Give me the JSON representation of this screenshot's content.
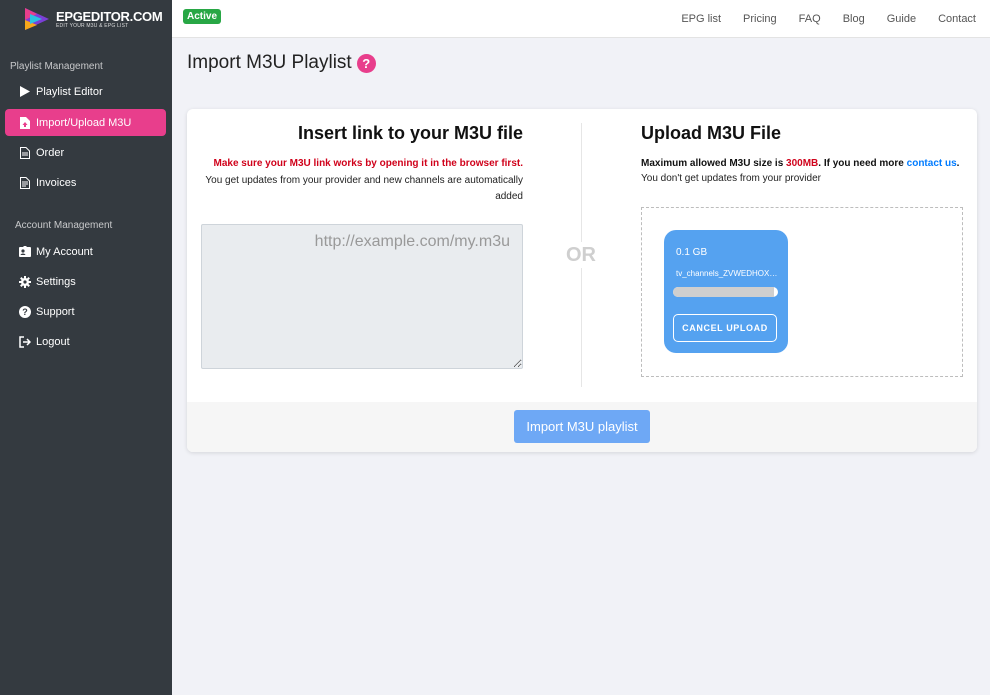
{
  "brand": {
    "name": "EPGEDITOR.COM",
    "tagline": "EDIT YOUR M3U & EPG LIST"
  },
  "sidebar": {
    "sections": [
      {
        "title": "Playlist Management"
      },
      {
        "title": "Account Management"
      }
    ],
    "items": [
      {
        "label": "Playlist Editor",
        "icon": "play-icon"
      },
      {
        "label": "Import/Upload M3U",
        "icon": "file-upload-icon",
        "active": true
      },
      {
        "label": "Order",
        "icon": "file-icon"
      },
      {
        "label": "Invoices",
        "icon": "file-text-icon"
      },
      {
        "label": "My Account",
        "icon": "id-card-icon"
      },
      {
        "label": "Settings",
        "icon": "gear-icon"
      },
      {
        "label": "Support",
        "icon": "question-circle-icon"
      },
      {
        "label": "Logout",
        "icon": "sign-out-icon"
      }
    ]
  },
  "topbar": {
    "status_badge": "Active",
    "links": [
      "EPG list",
      "Pricing",
      "FAQ",
      "Blog",
      "Guide",
      "Contact"
    ]
  },
  "page": {
    "title": "Import M3U Playlist",
    "help": "?"
  },
  "link_panel": {
    "title": "Insert link to your M3U file",
    "warning": "Make sure your M3U link works by opening it in the browser first.",
    "info": "You get updates from your provider and new channels are automatically added",
    "input_placeholder": "http://example.com/my.m3u",
    "input_value": ""
  },
  "separator": {
    "text": "OR"
  },
  "upload_panel": {
    "title": "Upload M3U File",
    "size_prefix": "Maximum allowed M3U size is ",
    "size_limit": "300MB",
    "size_middle": ". If you need more ",
    "contact_link": "contact us",
    "size_suffix": ".",
    "no_updates": "You don't get updates from your provider",
    "file": {
      "size": "0.1 GB",
      "name": "tv_channels_ZVWEDHOX…",
      "progress": 0.96,
      "cancel_label": "CANCEL UPLOAD"
    }
  },
  "footer": {
    "import_button": "Import M3U playlist"
  },
  "colors": {
    "sidebar_bg": "#343a40",
    "accent_pink": "#e83e8c",
    "status_green": "#28a745",
    "warning_red": "#d0021b",
    "link_blue": "#007bff",
    "file_preview_blue": "#55a2f0",
    "import_button_blue": "#6ea8f5"
  }
}
